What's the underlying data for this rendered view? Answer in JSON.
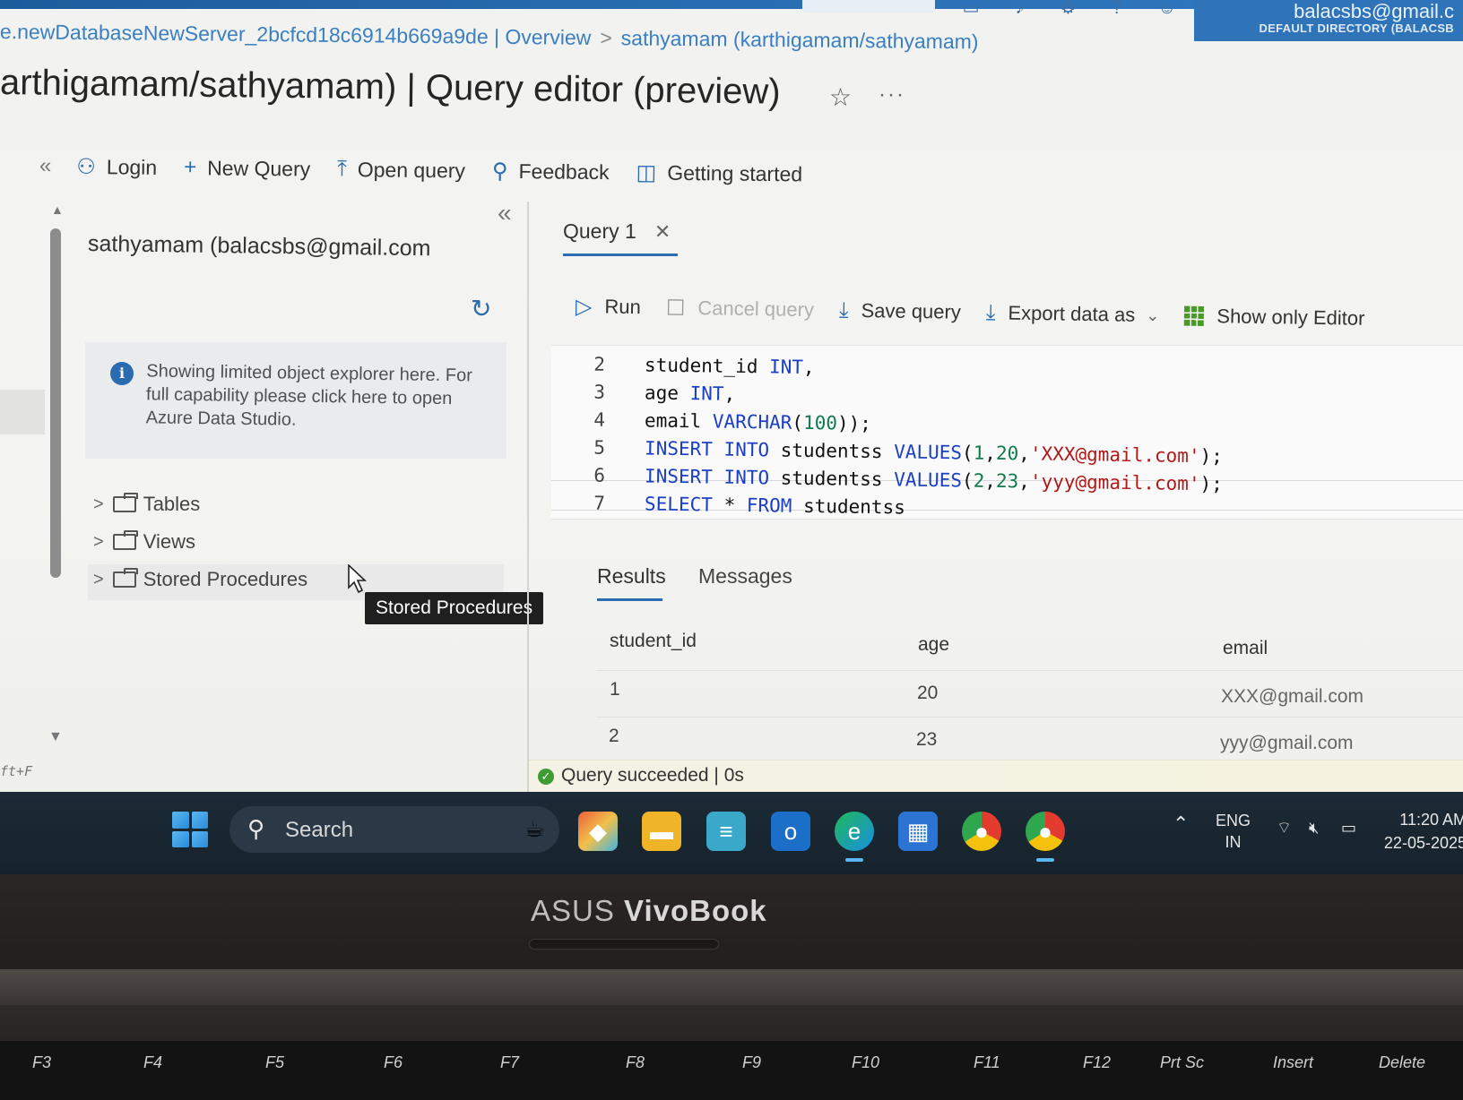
{
  "portal": {
    "breadcrumb": [
      "e.newDatabaseNewServer_2bcfcd18c6914b669a9de | Overview",
      "sathyamam (karthigamam/sathyamam)"
    ],
    "page_title": "arthigamam/sathyamam) | Query editor (preview)",
    "user_email": "balacsbs@gmail.c",
    "user_directory": "DEFAULT DIRECTORY (BALACSB"
  },
  "toolbar": {
    "login": "Login",
    "new_query": "New Query",
    "open_query": "Open query",
    "feedback": "Feedback",
    "getting_started": "Getting started"
  },
  "explorer": {
    "connection": "sathyamam (balacsbs@gmail.com",
    "info": "Showing limited object explorer here. For full capability please click here to open Azure Data Studio.",
    "items": [
      "Tables",
      "Views",
      "Stored Procedures"
    ],
    "tooltip": "Stored Procedures",
    "shortcut_hint": "ft+F"
  },
  "editor": {
    "tab_label": "Query 1",
    "buttons": {
      "run": "Run",
      "cancel": "Cancel query",
      "save": "Save query",
      "export": "Export data as",
      "show_editor": "Show only Editor"
    },
    "code_lines": [
      {
        "n": "2",
        "tokens": [
          {
            "t": "student_id ",
            "c": "tx"
          },
          {
            "t": "INT",
            "c": "kw"
          },
          {
            "t": ",",
            "c": "tx"
          }
        ]
      },
      {
        "n": "3",
        "tokens": [
          {
            "t": "age ",
            "c": "tx"
          },
          {
            "t": "INT",
            "c": "kw"
          },
          {
            "t": ",",
            "c": "tx"
          }
        ]
      },
      {
        "n": "4",
        "tokens": [
          {
            "t": "email ",
            "c": "tx"
          },
          {
            "t": "VARCHAR",
            "c": "kw"
          },
          {
            "t": "(",
            "c": "tx"
          },
          {
            "t": "100",
            "c": "num"
          },
          {
            "t": "));",
            "c": "tx"
          }
        ]
      },
      {
        "n": "5",
        "tokens": [
          {
            "t": "INSERT INTO ",
            "c": "kw"
          },
          {
            "t": "studentss ",
            "c": "tx"
          },
          {
            "t": "VALUES",
            "c": "kw"
          },
          {
            "t": "(",
            "c": "tx"
          },
          {
            "t": "1",
            "c": "num"
          },
          {
            "t": ",",
            "c": "tx"
          },
          {
            "t": "20",
            "c": "num"
          },
          {
            "t": ",",
            "c": "tx"
          },
          {
            "t": "'XXX@gmail.com'",
            "c": "str"
          },
          {
            "t": ");",
            "c": "tx"
          }
        ]
      },
      {
        "n": "6",
        "tokens": [
          {
            "t": "INSERT INTO ",
            "c": "kw"
          },
          {
            "t": "studentss ",
            "c": "tx"
          },
          {
            "t": "VALUES",
            "c": "kw"
          },
          {
            "t": "(",
            "c": "tx"
          },
          {
            "t": "2",
            "c": "num"
          },
          {
            "t": ",",
            "c": "tx"
          },
          {
            "t": "23",
            "c": "num"
          },
          {
            "t": ",",
            "c": "tx"
          },
          {
            "t": "'yyy@gmail.com'",
            "c": "str"
          },
          {
            "t": ");",
            "c": "tx"
          }
        ]
      },
      {
        "n": "7",
        "tokens": [
          {
            "t": "SELECT ",
            "c": "kw"
          },
          {
            "t": "* ",
            "c": "tx"
          },
          {
            "t": "FROM ",
            "c": "kw"
          },
          {
            "t": "studentss",
            "c": "tx"
          }
        ]
      }
    ]
  },
  "results": {
    "tabs": [
      "Results",
      "Messages"
    ],
    "columns": [
      "student_id",
      "age",
      "email"
    ],
    "rows": [
      [
        "1",
        "20",
        "XXX@gmail.com"
      ],
      [
        "2",
        "23",
        "yyy@gmail.com"
      ]
    ],
    "status": "Query succeeded | 0s"
  },
  "taskbar": {
    "search_label": "Search",
    "lang_line1": "ENG",
    "lang_line2": "IN",
    "time": "11:20 AM",
    "date": "22-05-2025"
  },
  "laptop": {
    "brand_light": "ASUS ",
    "brand_bold": "VivoBook",
    "keys": [
      "F3",
      "F4",
      "F5",
      "F6",
      "F7",
      "F8",
      "F9",
      "F10",
      "F11",
      "F12",
      "Prt Sc",
      "Insert",
      "Delete"
    ]
  },
  "colors": {
    "accent": "#2b6cb0",
    "keyword": "#1a3fc5",
    "string": "#b01818",
    "number": "#0f7a4a",
    "success": "#3f9c35"
  }
}
